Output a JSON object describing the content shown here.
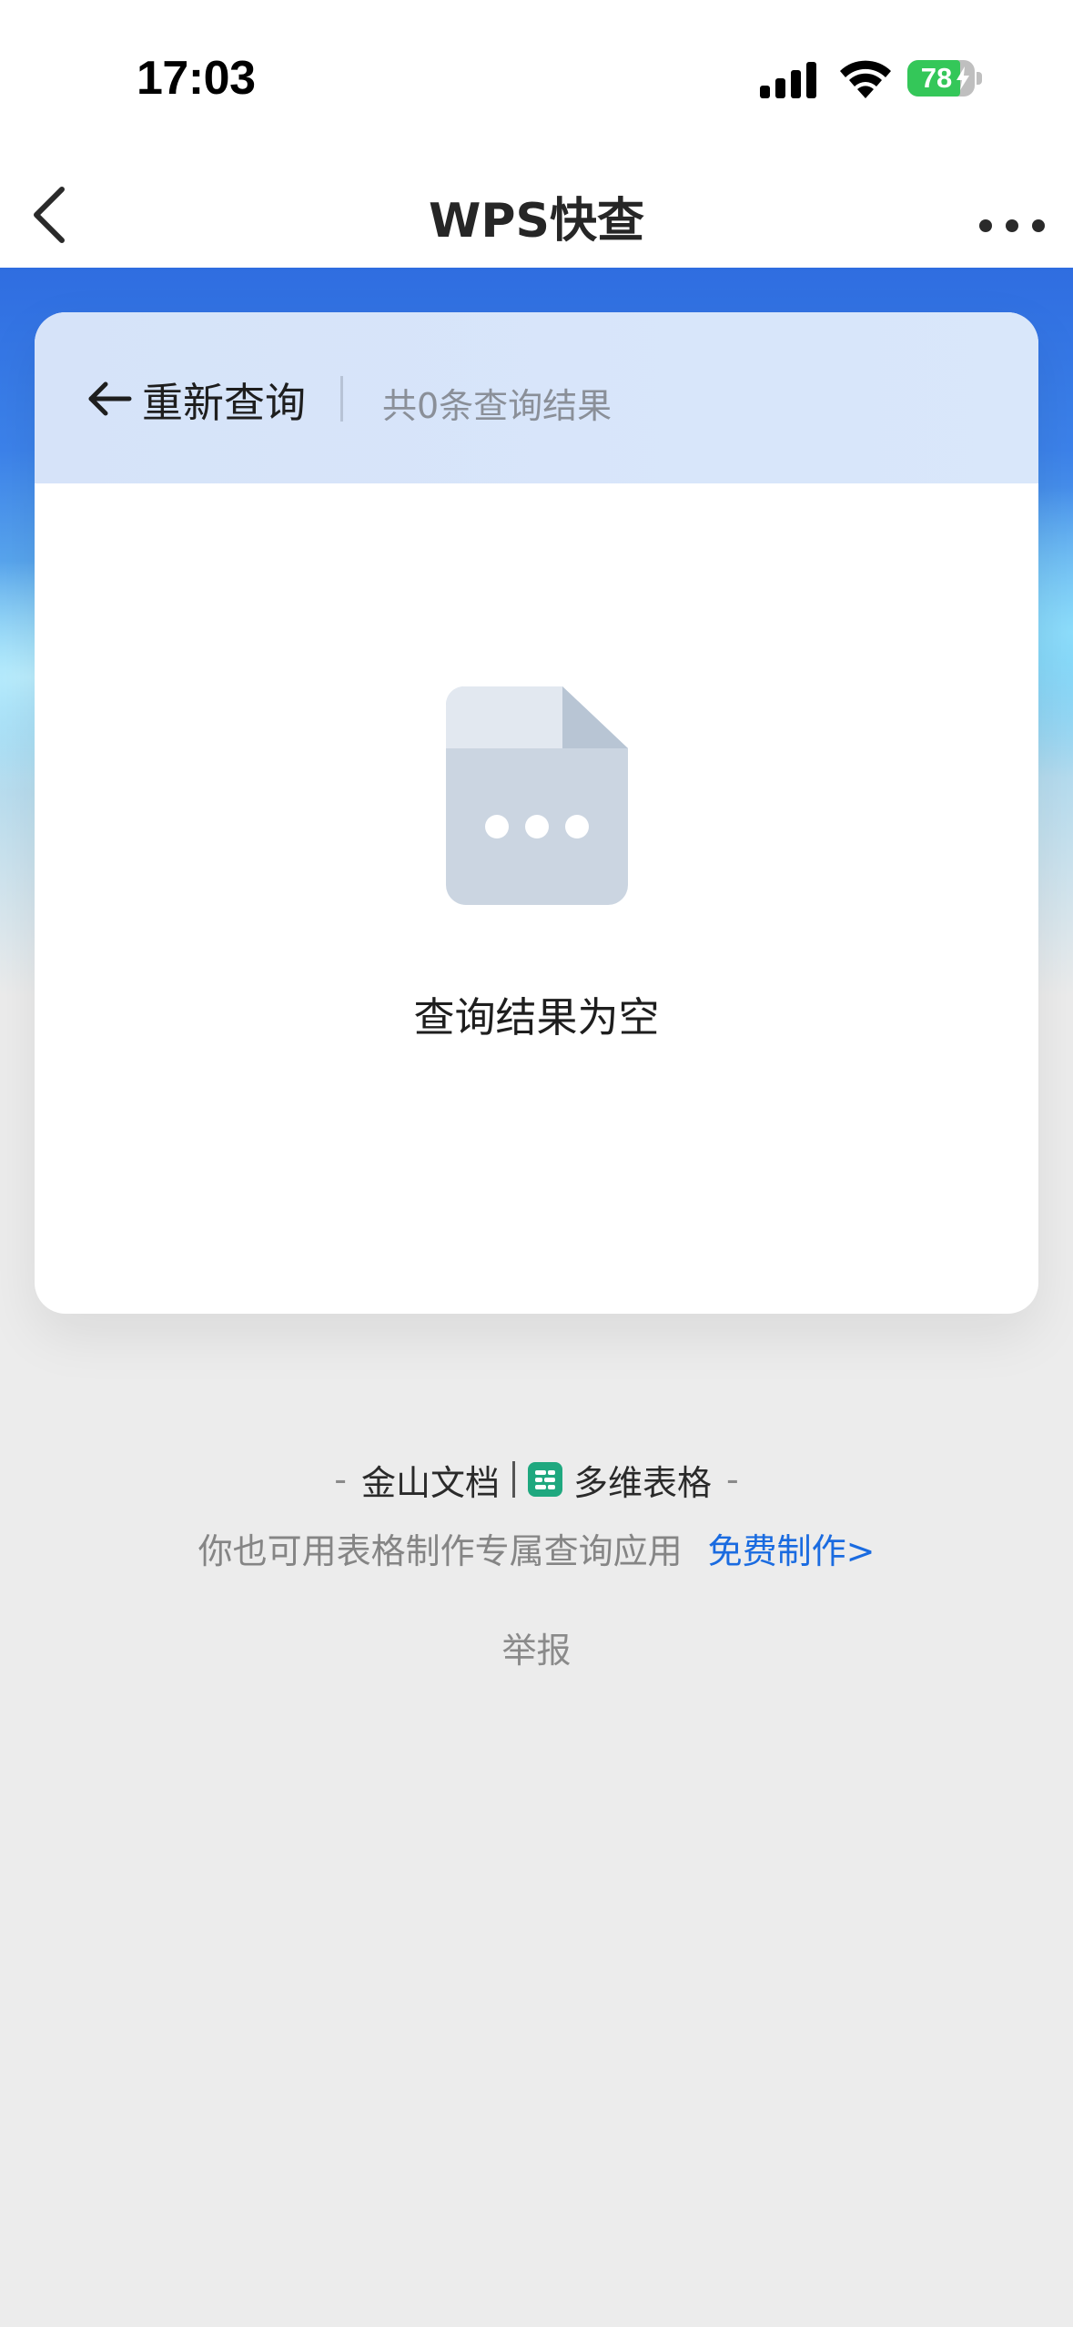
{
  "status_bar": {
    "time": "17:03",
    "battery_level": "78",
    "battery_charging": true,
    "icons": [
      "signal-icon",
      "wifi-icon",
      "battery-icon"
    ]
  },
  "nav": {
    "title": "WPS快查",
    "back_icon": "chevron-left-icon",
    "more_icon": "more-horizontal-icon"
  },
  "card": {
    "requery_label": "重新查询",
    "requery_icon": "arrow-left-icon",
    "result_count": "共0条查询结果",
    "empty_icon": "empty-document-icon",
    "empty_text": "查询结果为空"
  },
  "footer": {
    "brand_left": "金山文档",
    "brand_right": "多维表格",
    "dash": "-",
    "promo_text": "你也可用表格制作专属查询应用",
    "promo_link": "免费制作>",
    "report": "举报"
  },
  "colors": {
    "accent": "#1a6be0",
    "banner_top": "#2f6de0",
    "card_header": "#d6e3f9",
    "battery_green": "#34c759",
    "sheet_icon": "#1fa87f"
  }
}
